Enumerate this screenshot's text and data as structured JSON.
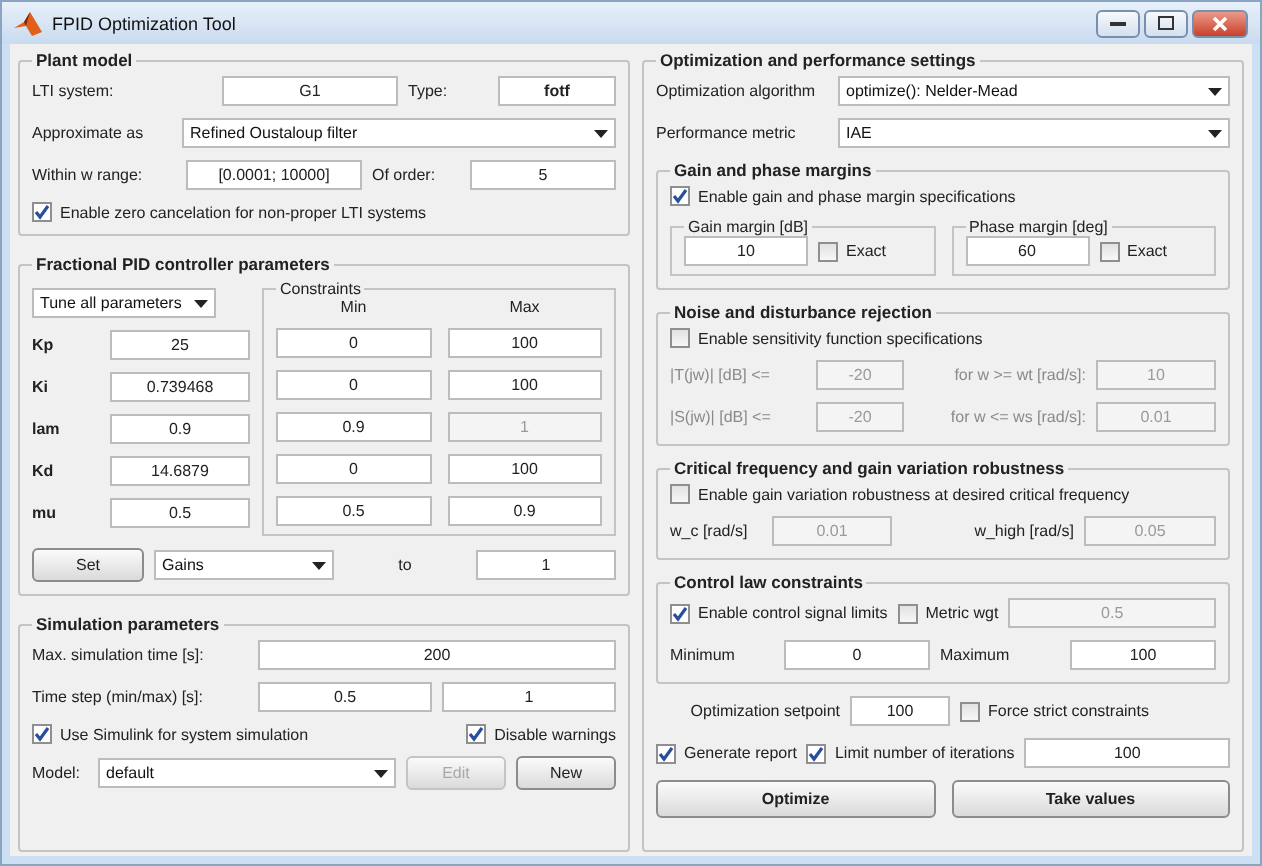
{
  "window": {
    "title": "FPID Optimization Tool"
  },
  "plant_model": {
    "title": "Plant model",
    "lti_label": "LTI system:",
    "lti_value": "G1",
    "type_label": "Type:",
    "type_value": "fotf",
    "approx_label": "Approximate as",
    "approx_value": "Refined Oustaloup filter",
    "range_label": "Within w range:",
    "range_value": "[0.0001; 10000]",
    "order_label": "Of order:",
    "order_value": "5",
    "zero_cancel": {
      "label": "Enable zero cancelation for non-proper LTI systems",
      "checked": true
    }
  },
  "fpid": {
    "title": "Fractional PID controller parameters",
    "tune_mode": "Tune all parameters",
    "constraints_title": "Constraints",
    "columns": [
      "Min",
      "Max"
    ],
    "params": [
      {
        "name": "Kp",
        "value": "25",
        "min": "0",
        "max": "100",
        "max_disabled": false
      },
      {
        "name": "Ki",
        "value": "0.739468",
        "min": "0",
        "max": "100",
        "max_disabled": false
      },
      {
        "name": "lam",
        "value": "0.9",
        "min": "0.9",
        "max": "1",
        "max_disabled": true
      },
      {
        "name": "Kd",
        "value": "14.6879",
        "min": "0",
        "max": "100",
        "max_disabled": false
      },
      {
        "name": "mu",
        "value": "0.5",
        "min": "0.5",
        "max": "0.9",
        "max_disabled": false
      }
    ],
    "set_button": "Set",
    "set_target": "Gains",
    "to_label": "to",
    "to_value": "1"
  },
  "simulation": {
    "title": "Simulation parameters",
    "max_time_label": "Max. simulation time [s]:",
    "max_time": "200",
    "step_label": "Time step (min/max) [s]:",
    "step_min": "0.5",
    "step_max": "1",
    "use_simulink": {
      "label": "Use Simulink for system simulation",
      "checked": true
    },
    "disable_warnings": {
      "label": "Disable warnings",
      "checked": true
    },
    "model_label": "Model:",
    "model_value": "default",
    "edit_button": {
      "label": "Edit",
      "disabled": true
    },
    "new_button": {
      "label": "New",
      "disabled": false
    }
  },
  "optimization": {
    "title": "Optimization and performance settings",
    "algorithm_label": "Optimization algorithm",
    "algorithm_value": "optimize(): Nelder-Mead",
    "metric_label": "Performance metric",
    "metric_value": "IAE",
    "margins": {
      "title": "Gain and phase margins",
      "enable": {
        "label": "Enable gain and phase margin specifications",
        "checked": true
      },
      "gain": {
        "title": "Gain margin [dB]",
        "value": "10",
        "exact": {
          "label": "Exact",
          "checked": false
        }
      },
      "phase": {
        "title": "Phase margin [deg]",
        "value": "60",
        "exact": {
          "label": "Exact",
          "checked": false
        }
      }
    },
    "noise": {
      "title": "Noise and disturbance rejection",
      "enable": {
        "label": "Enable sensitivity function specifications",
        "checked": false
      },
      "rows": [
        {
          "label": "|T(jw)| [dB] <=",
          "value": "-20",
          "freq_label": "for w >= wt [rad/s]:",
          "freq_value": "10"
        },
        {
          "label": "|S(jw)| [dB] <=",
          "value": "-20",
          "freq_label": "for w <= ws [rad/s]:",
          "freq_value": "0.01"
        }
      ]
    },
    "robustness": {
      "title": "Critical frequency and gain variation robustness",
      "enable": {
        "label": "Enable gain variation robustness at desired critical frequency",
        "checked": false
      },
      "wc_label": "w_c [rad/s]",
      "wc_value": "0.01",
      "wh_label": "w_high [rad/s]",
      "wh_value": "0.05"
    },
    "control_law": {
      "title": "Control law constraints",
      "enable": {
        "label": "Enable control signal limits",
        "checked": true
      },
      "metric": {
        "label": "Metric wgt",
        "checked": false
      },
      "metric_value": "0.5",
      "min_label": "Minimum",
      "min_value": "0",
      "max_label": "Maximum",
      "max_value": "100"
    },
    "setpoint_label": "Optimization setpoint",
    "setpoint_value": "100",
    "force_strict": {
      "label": "Force strict constraints",
      "checked": false
    },
    "generate_report": {
      "label": "Generate report",
      "checked": true
    },
    "limit_iterations": {
      "label": "Limit number of iterations",
      "checked": true
    },
    "iterations_value": "100",
    "buttons": [
      "Optimize",
      "Take values"
    ]
  }
}
